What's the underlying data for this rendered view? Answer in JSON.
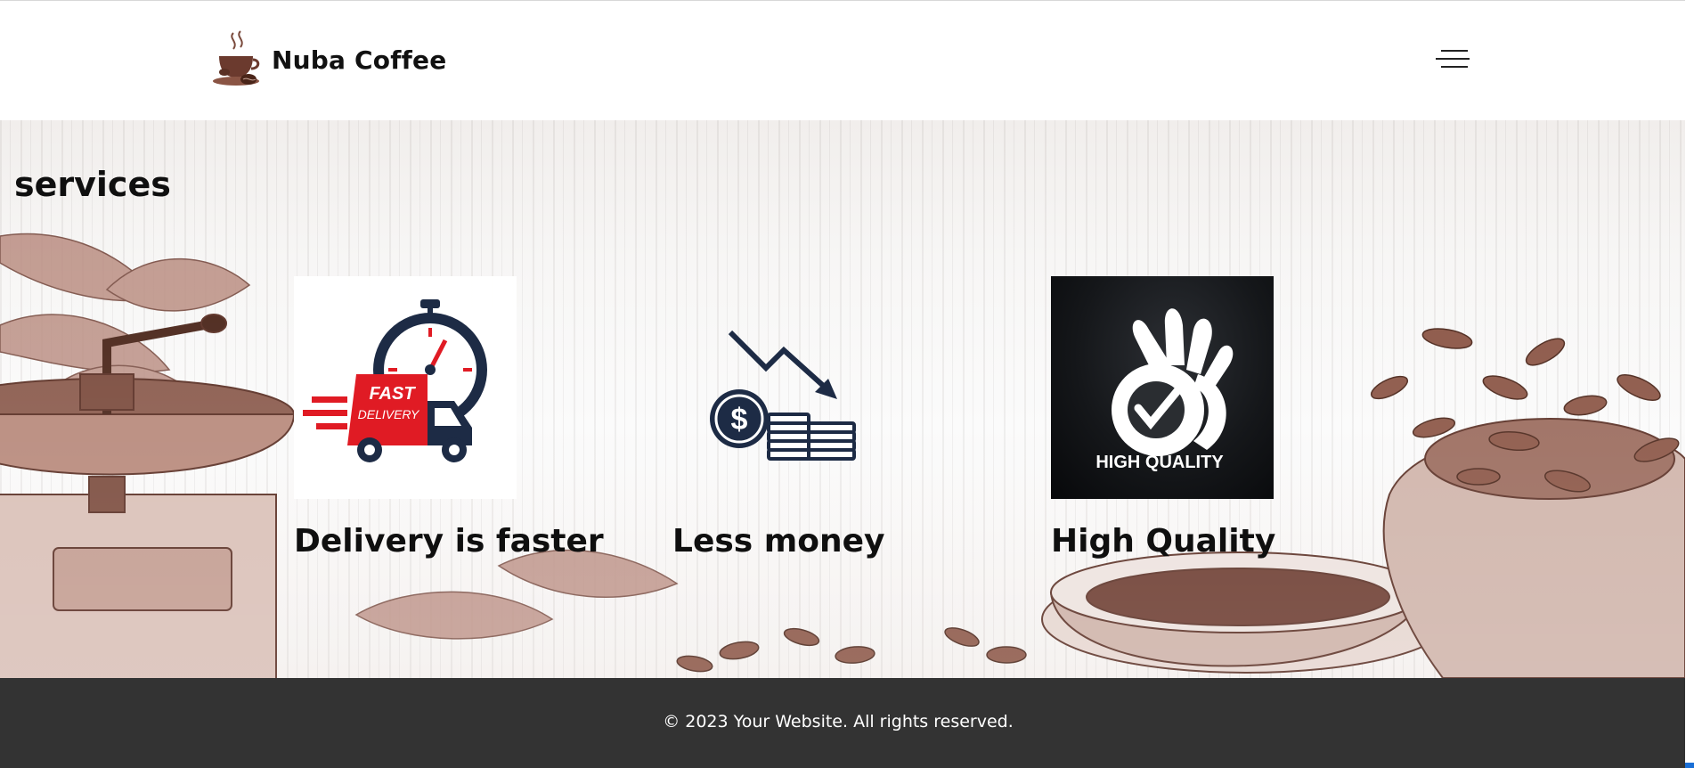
{
  "header": {
    "brand": "Nuba Coffee",
    "logo_icon": "coffee-cup-logo-icon",
    "menu_icon": "hamburger-menu-icon"
  },
  "services": {
    "title": "services",
    "items": [
      {
        "label": "Delivery is faster",
        "icon": "fast-delivery-icon",
        "icon_text_1": "FAST",
        "icon_text_2": "DELIVERY"
      },
      {
        "label": "Less money",
        "icon": "price-drop-coins-icon"
      },
      {
        "label": "High Quality",
        "icon": "high-quality-ok-hand-icon",
        "icon_text": "HIGH QUALITY"
      }
    ]
  },
  "footer": {
    "text": "© 2023 Your Website. All rights reserved."
  },
  "colors": {
    "footer_bg": "#333333",
    "navy": "#1d2b45",
    "red": "#e01b24",
    "sepia": "#6b3a2e"
  }
}
